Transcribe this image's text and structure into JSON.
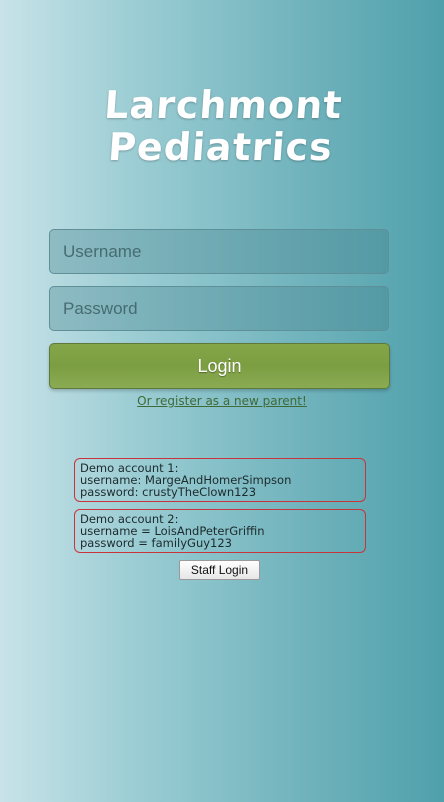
{
  "logo": {
    "line1": "Larchmont",
    "line2": "Pediatrics"
  },
  "login_form": {
    "username_placeholder": "Username",
    "password_placeholder": "Password",
    "login_label": "Login",
    "register_link": "Or register as a new parent!"
  },
  "demo_accounts": [
    {
      "heading": "Demo account 1:",
      "username_line": "username: MargeAndHomerSimpson",
      "password_line": "password: crustyTheClown123"
    },
    {
      "heading": "Demo account 2:",
      "username_line": "username = LoisAndPeterGriffin",
      "password_line": "password = familyGuy123"
    }
  ],
  "staff_login_label": "Staff Login",
  "colors": {
    "login_button": "#7c9e42",
    "demo_border": "#c9343a",
    "background_left": "#c8e3e8",
    "background_right": "#4fa0ab"
  }
}
